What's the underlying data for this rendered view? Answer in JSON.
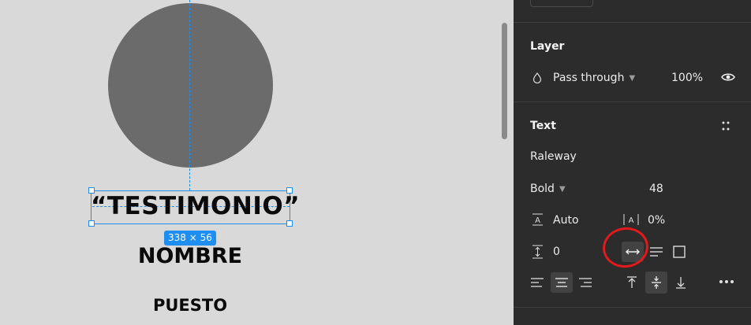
{
  "canvas": {
    "headline": "“TESTIMONIO”",
    "size_badge": "338 × 56",
    "name": "NOMBRE",
    "role": "PUESTO"
  },
  "layer": {
    "heading": "Layer",
    "blend_mode": "Pass through",
    "opacity": "100%"
  },
  "text": {
    "heading": "Text",
    "font_family": "Raleway",
    "font_weight": "Bold",
    "font_size": "48",
    "line_height": "Auto",
    "letter_spacing": "0%",
    "paragraph_spacing": "0"
  },
  "icons": {
    "blend": "drop-icon",
    "visibility": "eye-icon",
    "styles": "grid-dots-icon",
    "line_height": "line-height-icon",
    "letter_spacing": "letter-spacing-icon",
    "paragraph_spacing": "paragraph-spacing-icon",
    "auto_width": "auto-width-icon",
    "auto_height": "auto-height-icon",
    "fixed_size": "fixed-size-icon",
    "align_left": "align-left-icon",
    "align_center": "align-center-icon",
    "align_right": "align-right-icon",
    "align_top": "align-top-icon",
    "align_middle": "align-middle-icon",
    "align_bottom": "align-bottom-icon",
    "more": "more-icon"
  },
  "colors": {
    "selection": "#1e8ef0",
    "panel_bg": "#2c2c2c",
    "annotation": "#e11b1b"
  }
}
